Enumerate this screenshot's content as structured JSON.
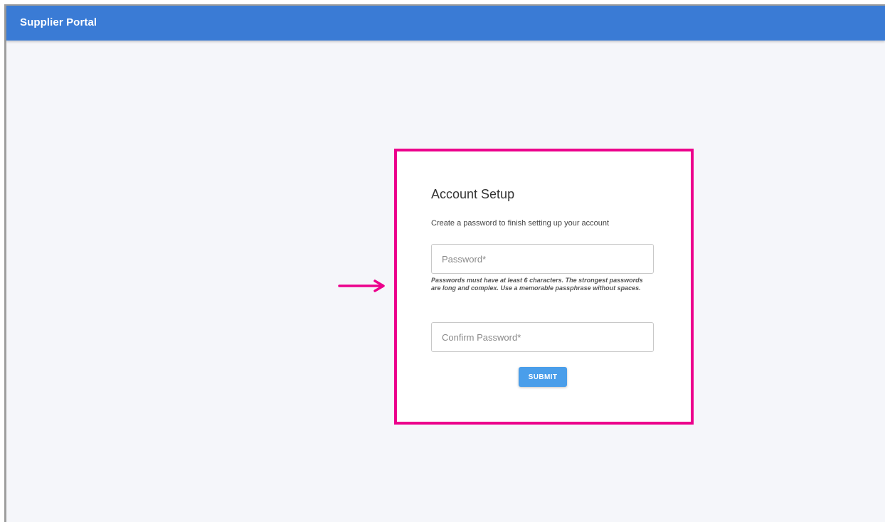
{
  "header": {
    "title": "Supplier Portal"
  },
  "account_setup": {
    "title": "Account Setup",
    "subtitle": "Create a password to finish setting up your account",
    "password_placeholder": "Password*",
    "password_value": "",
    "helper_text": "Passwords must have at least 6 characters. The strongest passwords are long and complex. Use a memorable passphrase without spaces.",
    "confirm_placeholder": "Confirm Password*",
    "confirm_value": "",
    "submit_label": "SUBMIT"
  },
  "annotation": {
    "highlight_color": "#ec008c",
    "arrow_icon": "arrow-right-icon"
  },
  "colors": {
    "header_bg": "#3a7bd5",
    "button_bg": "#4a9eea",
    "page_bg": "#f5f6fa"
  }
}
